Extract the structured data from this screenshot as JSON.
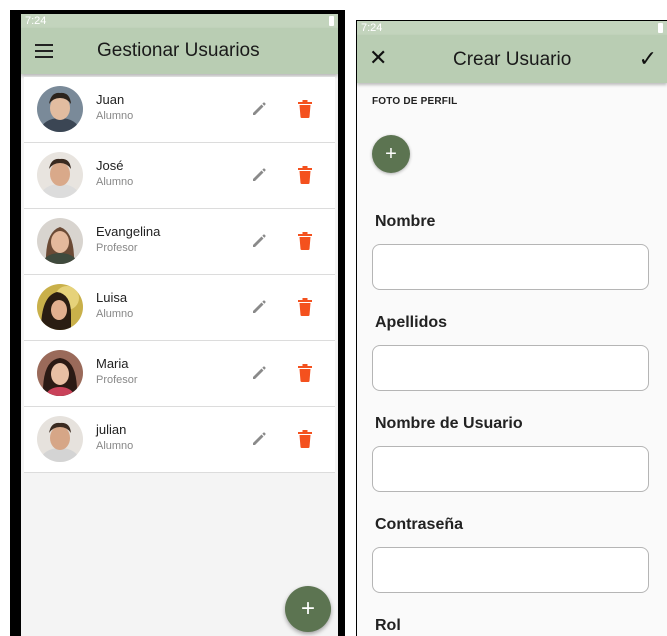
{
  "left": {
    "status_time": "7:24",
    "title": "Gestionar Usuarios",
    "users": [
      {
        "name": "Juan",
        "role": "Alumno"
      },
      {
        "name": "José",
        "role": "Alumno"
      },
      {
        "name": "Evangelina",
        "role": "Profesor"
      },
      {
        "name": "Luisa",
        "role": "Alumno"
      },
      {
        "name": "Maria",
        "role": "Profesor"
      },
      {
        "name": "julian",
        "role": "Alumno"
      }
    ],
    "fab_label": "+"
  },
  "right": {
    "status_time": "7:24",
    "title": "Crear Usuario",
    "close_glyph": "✕",
    "confirm_glyph": "✓",
    "photo_label": "FOTO DE PERFIL",
    "photo_add_glyph": "+",
    "fields": [
      {
        "label": "Nombre",
        "value": ""
      },
      {
        "label": "Apellidos",
        "value": ""
      },
      {
        "label": "Nombre de Usuario",
        "value": ""
      },
      {
        "label": "Contraseña",
        "value": ""
      },
      {
        "label": "Rol",
        "value": ""
      }
    ]
  },
  "colors": {
    "appbar": "#b9cdb3",
    "fab": "#5c7451",
    "delete": "#f4511e",
    "edit": "#8a8a8a"
  },
  "icons": {
    "menu": "hamburger-menu-icon",
    "edit": "pencil-icon",
    "delete": "trash-icon",
    "add": "plus-icon",
    "close": "close-icon",
    "confirm": "check-icon"
  }
}
